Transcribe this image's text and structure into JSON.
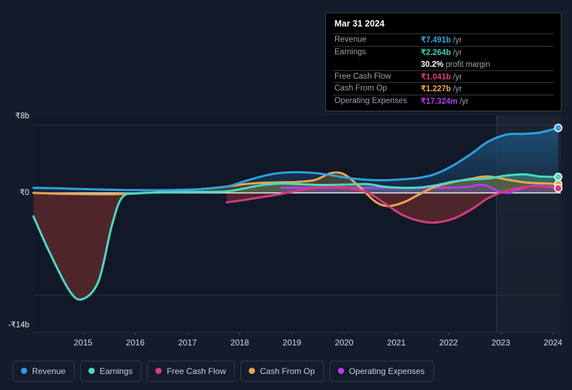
{
  "tooltip": {
    "date": "Mar 31 2024",
    "rows": [
      {
        "label": "Revenue",
        "value": "₹7.491b",
        "unit": "/yr",
        "color": "#3aa0e8"
      },
      {
        "label": "Earnings",
        "value": "₹2.264b",
        "unit": "/yr",
        "color": "#3fd1b4"
      },
      {
        "label": "",
        "value": "30.2%",
        "unit": "profit margin",
        "color": "#ffffff"
      },
      {
        "label": "Free Cash Flow",
        "value": "₹1.041b",
        "unit": "/yr",
        "color": "#d8407c"
      },
      {
        "label": "Cash From Op",
        "value": "₹1.227b",
        "unit": "/yr",
        "color": "#e8a84a"
      },
      {
        "label": "Operating Expenses",
        "value": "₹17.324m",
        "unit": "/yr",
        "color": "#b23ee8"
      }
    ]
  },
  "legend": {
    "items": [
      {
        "label": "Revenue",
        "color": "#2e9fe0"
      },
      {
        "label": "Earnings",
        "color": "#4dd8c0"
      },
      {
        "label": "Free Cash Flow",
        "color": "#d13b7e"
      },
      {
        "label": "Cash From Op",
        "color": "#e8a84a"
      },
      {
        "label": "Operating Expenses",
        "color": "#b23ee8"
      }
    ]
  },
  "chart_data": {
    "type": "area",
    "title": "",
    "xlabel": "",
    "ylabel": "",
    "currency": "₹",
    "ylim": [
      -14,
      8
    ],
    "y_ticks": [
      {
        "label": "₹8b",
        "value": 8
      },
      {
        "label": "₹0",
        "value": 0
      },
      {
        "label": "-₹14b",
        "value": -14
      }
    ],
    "x_ticks": [
      "2015",
      "2016",
      "2017",
      "2018",
      "2019",
      "2020",
      "2021",
      "2022",
      "2023",
      "2024"
    ],
    "x_range": [
      2014.3,
      2024.4
    ],
    "grid": true,
    "legend_position": "bottom",
    "forecast_divider_year": 2023.17,
    "series": [
      {
        "name": "Revenue",
        "color": "#2e9fe0",
        "fill": "#16334c",
        "x": [
          2014.3,
          2014.75,
          2015.0,
          2015.5,
          2016.0,
          2016.5,
          2017.0,
          2017.5,
          2018.0,
          2018.35,
          2018.7,
          2019.0,
          2019.35,
          2019.7,
          2020.0,
          2020.35,
          2020.7,
          2021.0,
          2021.35,
          2021.7,
          2022.0,
          2022.35,
          2022.7,
          2023.0,
          2023.35,
          2023.7,
          2024.0,
          2024.35
        ],
        "y": [
          0.6,
          0.55,
          0.5,
          0.42,
          0.35,
          0.33,
          0.35,
          0.45,
          0.75,
          1.4,
          2.0,
          2.35,
          2.45,
          2.35,
          2.1,
          1.75,
          1.55,
          1.5,
          1.6,
          1.8,
          2.25,
          3.3,
          4.7,
          6.05,
          6.9,
          7.0,
          7.15,
          7.7
        ]
      },
      {
        "name": "Earnings",
        "color": "#4dd8c0",
        "fill_pos": "#2f6b63",
        "fill_neg": "#4a2028",
        "x": [
          2014.3,
          2014.6,
          2015.0,
          2015.25,
          2015.55,
          2015.8,
          2016.0,
          2016.3,
          2016.7,
          2017.0,
          2017.5,
          2018.0,
          2018.35,
          2018.7,
          2019.0,
          2019.35,
          2019.7,
          2020.0,
          2020.35,
          2020.7,
          2021.0,
          2021.35,
          2021.7,
          2022.0,
          2022.35,
          2022.7,
          2023.0,
          2023.35,
          2023.7,
          2024.0,
          2024.35
        ],
        "y": [
          -3.2,
          -8.0,
          -13.5,
          -14.5,
          -12.0,
          -4.5,
          -0.6,
          -0.05,
          0.05,
          0.1,
          0.12,
          0.18,
          0.55,
          0.95,
          1.1,
          1.05,
          0.95,
          0.95,
          1.0,
          1.05,
          0.75,
          0.6,
          0.65,
          0.9,
          1.35,
          1.6,
          1.7,
          2.05,
          2.2,
          1.95,
          1.9
        ]
      },
      {
        "name": "Free Cash Flow",
        "color": "#d13b7e",
        "fill": "#4a2028",
        "x": [
          2018.0,
          2018.35,
          2018.7,
          2019.0,
          2019.35,
          2019.7,
          2020.0,
          2020.35,
          2020.7,
          2021.0,
          2021.35,
          2021.7,
          2022.0,
          2022.35,
          2022.7,
          2023.0,
          2023.35,
          2023.7,
          2024.0,
          2024.35
        ],
        "y": [
          -1.3,
          -0.95,
          -0.55,
          -0.2,
          0.25,
          0.6,
          0.75,
          0.55,
          0.05,
          -1.3,
          -2.95,
          -3.85,
          -4.05,
          -3.5,
          -2.2,
          -0.75,
          0.25,
          0.7,
          0.8,
          0.55
        ]
      },
      {
        "name": "Cash From Op",
        "color": "#e8a84a",
        "fill": "#5c4a2a",
        "x": [
          2014.3,
          2014.75,
          2015.2,
          2015.7,
          2016.2,
          2016.7,
          2017.0,
          2017.5,
          2018.0,
          2018.35,
          2018.7,
          2019.0,
          2019.35,
          2019.7,
          2020.0,
          2020.25,
          2020.55,
          2020.85,
          2021.1,
          2021.4,
          2021.7,
          2022.0,
          2022.35,
          2022.7,
          2023.0,
          2023.35,
          2023.7,
          2024.0,
          2024.35
        ],
        "y": [
          0.0,
          -0.1,
          -0.15,
          -0.18,
          -0.1,
          0.1,
          0.25,
          0.45,
          0.75,
          1.05,
          1.2,
          1.25,
          1.3,
          1.55,
          2.35,
          2.2,
          0.7,
          -1.2,
          -1.8,
          -1.25,
          -0.15,
          0.75,
          1.3,
          1.7,
          1.95,
          1.6,
          1.25,
          1.15,
          1.05
        ]
      },
      {
        "name": "Operating Expenses",
        "color": "#b23ee8",
        "fill": "#4a3560",
        "x": [
          2019.05,
          2019.5,
          2020.0,
          2020.5,
          2021.0,
          2021.5,
          2022.0,
          2022.3,
          2022.6,
          2022.85,
          2023.0,
          2023.2,
          2023.4,
          2023.6,
          2023.85,
          2024.1,
          2024.35
        ],
        "y": [
          0.6,
          0.6,
          0.6,
          0.6,
          0.6,
          0.6,
          0.6,
          0.62,
          0.7,
          0.95,
          0.8,
          0.2,
          0.0,
          0.45,
          0.85,
          0.82,
          0.6
        ]
      }
    ]
  }
}
